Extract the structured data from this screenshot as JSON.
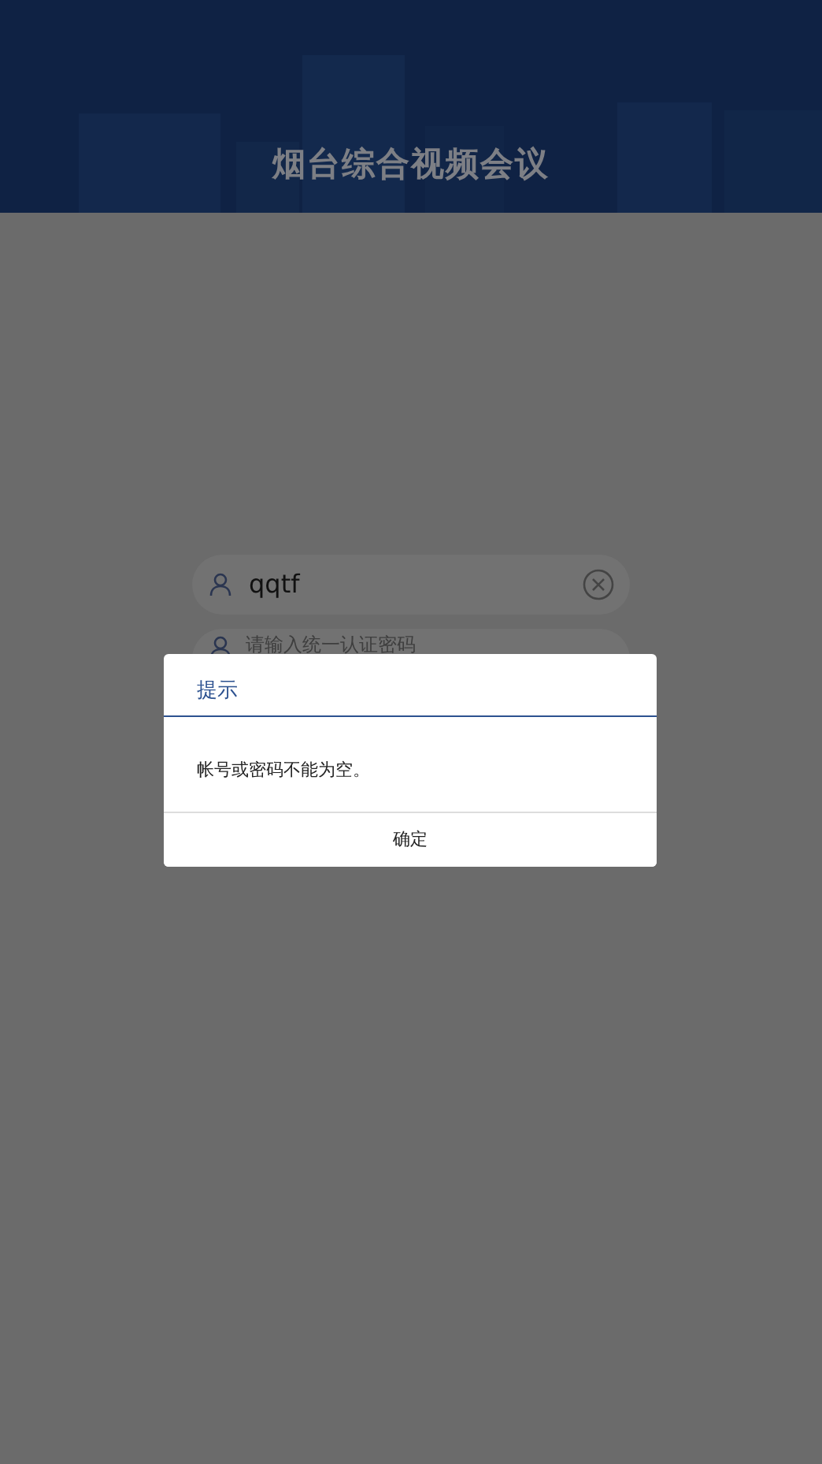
{
  "header": {
    "title": "烟台综合视频会议"
  },
  "login": {
    "username": {
      "value": "qqtf"
    },
    "password": {
      "placeholder": "请输入统一认证密码"
    }
  },
  "dialog": {
    "title": "提示",
    "message": "帐号或密码不能为空。",
    "buttons": [
      "确定"
    ]
  }
}
